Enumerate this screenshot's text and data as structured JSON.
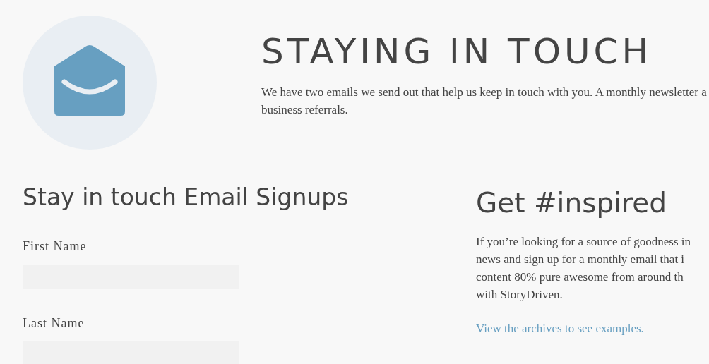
{
  "header": {
    "title": "STAYING IN TOUCH",
    "intro_lines": [
      "We have two emails we send out that help us keep in touch with you. A monthly newsletter a",
      "business referrals."
    ]
  },
  "signup": {
    "heading": "Stay in touch Email Signups",
    "fields": [
      {
        "label": "First Name"
      },
      {
        "label": "Last Name"
      }
    ]
  },
  "inspired": {
    "heading": "Get #inspired",
    "body_lines": [
      "If you’re looking for a source of goodness in",
      "news and sign up for a monthly email that i",
      "content 80% pure awesome from around th",
      "with StoryDriven."
    ],
    "link": "View the archives to see examples."
  }
}
